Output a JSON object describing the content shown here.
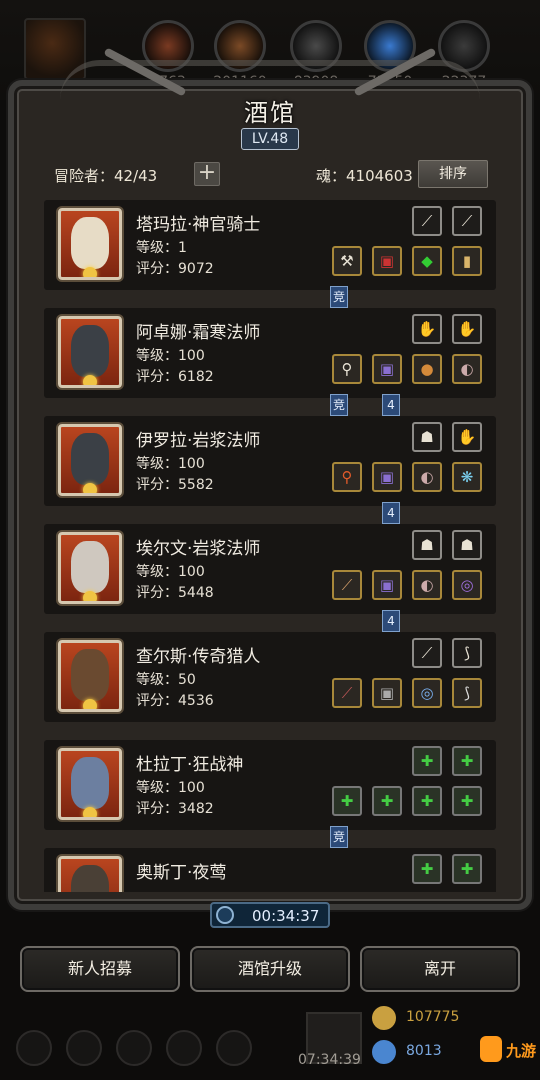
{
  "header": {
    "resources": [
      "1763",
      "201160",
      "83908",
      "73650",
      "22377"
    ],
    "title": "酒馆",
    "level": "LV.48"
  },
  "roster": {
    "adventurers_label": "冒险者：42/43",
    "plus_label": "+",
    "soul_label": "魂：4104603",
    "sort_label": "排序"
  },
  "heroes": [
    {
      "name": "塔玛拉·神官骑士",
      "level": "等级：1",
      "score": "评分：9072",
      "tags": [
        "竞"
      ]
    },
    {
      "name": "阿卓娜·霜寒法师",
      "level": "等级：100",
      "score": "评分：6182",
      "tags": [
        "竞",
        "4"
      ]
    },
    {
      "name": "伊罗拉·岩浆法师",
      "level": "等级：100",
      "score": "评分：5582",
      "tags": [
        "4"
      ]
    },
    {
      "name": "埃尔文·岩浆法师",
      "level": "等级：100",
      "score": "评分：5448",
      "tags": [
        "4"
      ]
    },
    {
      "name": "查尔斯·传奇猎人",
      "level": "等级：50",
      "score": "评分：4536",
      "tags": []
    },
    {
      "name": "杜拉丁·狂战神",
      "level": "等级：100",
      "score": "评分：3482",
      "tags": [
        "竞"
      ]
    },
    {
      "name": "奥斯丁·夜莺",
      "level": "",
      "score": "",
      "tags": []
    }
  ],
  "timer": "00:34:37",
  "buttons": {
    "recruit": "新人招募",
    "upgrade": "酒馆升级",
    "leave": "离开"
  },
  "status": {
    "clock": "07:34:39",
    "gold": "107775",
    "gems": "8013",
    "watermark": "九游"
  },
  "colors": {
    "gold_border": "#a8883a",
    "tag_blue": "#2c4a78",
    "portrait_red": "#b9451f"
  }
}
